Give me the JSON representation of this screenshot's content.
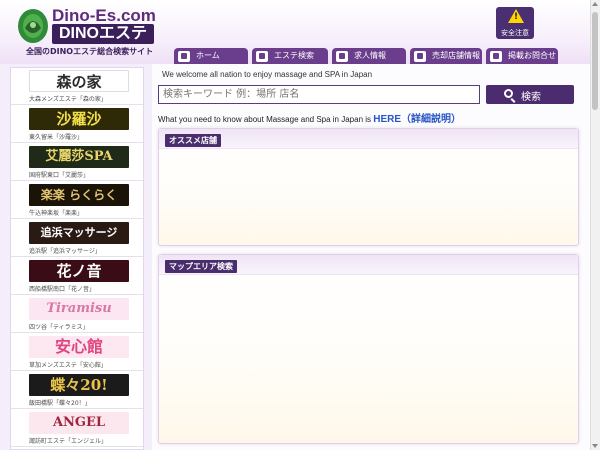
{
  "header": {
    "logo_top": "Dino-Es.com",
    "logo_main": "DINOエステ",
    "logo_sub": "全国のDINOエステ総合検索サイト",
    "notice_label": "安全注意",
    "notice_mark": "!"
  },
  "nav": [
    {
      "label": "ホーム",
      "icon": "home-icon"
    },
    {
      "label": "エステ検索",
      "icon": "search-icon"
    },
    {
      "label": "求人情報",
      "icon": "job-icon"
    },
    {
      "label": "売却店舗情報",
      "icon": "store-icon"
    },
    {
      "label": "掲載お問合せ",
      "icon": "contact-icon"
    }
  ],
  "sidebar": {
    "items": [
      {
        "banner": "森の家",
        "caption": "大森メンズエステ「森の家」",
        "bg": "#ffffff",
        "fg": "#2b2b2b"
      },
      {
        "banner": "沙羅沙",
        "caption": "東久留米「沙羅沙」",
        "bg": "#2e2a08",
        "fg": "#f2e04a"
      },
      {
        "banner": "艾麗莎SPA",
        "caption": "国府駅東口「艾麗莎」",
        "bg": "#1f2a18",
        "fg": "#e9d66a"
      },
      {
        "banner": "楽楽 らくらく",
        "caption": "牛込神楽坂「楽楽」",
        "bg": "#1a1308",
        "fg": "#e3c370"
      },
      {
        "banner": "追浜マッサージ",
        "caption": "追浜駅「追浜マッサージ」",
        "bg": "#2a1a14",
        "fg": "#ffffff"
      },
      {
        "banner": "花ノ音",
        "caption": "西船橋駅南口「花ノ音」",
        "bg": "#3a0c16",
        "fg": "#ffffff"
      },
      {
        "banner": "Tiramisu",
        "caption": "四ツ谷「ティラミス」",
        "bg": "#fbe6f1",
        "fg": "#d977a8"
      },
      {
        "banner": "安心館",
        "caption": "草加メンズエステ「安心館」",
        "bg": "#fde8f2",
        "fg": "#e0457f"
      },
      {
        "banner": "蝶々20!",
        "caption": "飯田橋駅「蝶々20！」",
        "bg": "#1b1b1b",
        "fg": "#e8c44a"
      },
      {
        "banner": "ANGEL",
        "caption": "諏訪町エステ「エンジェル」",
        "bg": "#fde7ef",
        "fg": "#a0243d"
      }
    ]
  },
  "main": {
    "welcome": "We welcome all nation to enjoy massage and SPA in Japan",
    "search_placeholder": "検索キーワード 例：場所 店名",
    "search_button": "検索",
    "info_text": "What you need to know about Massage and Spa in Japan is ",
    "info_link": "HERE（詳細説明）",
    "panel1_title": "オススメ店舗",
    "panel2_title": "マップエリア検索"
  }
}
